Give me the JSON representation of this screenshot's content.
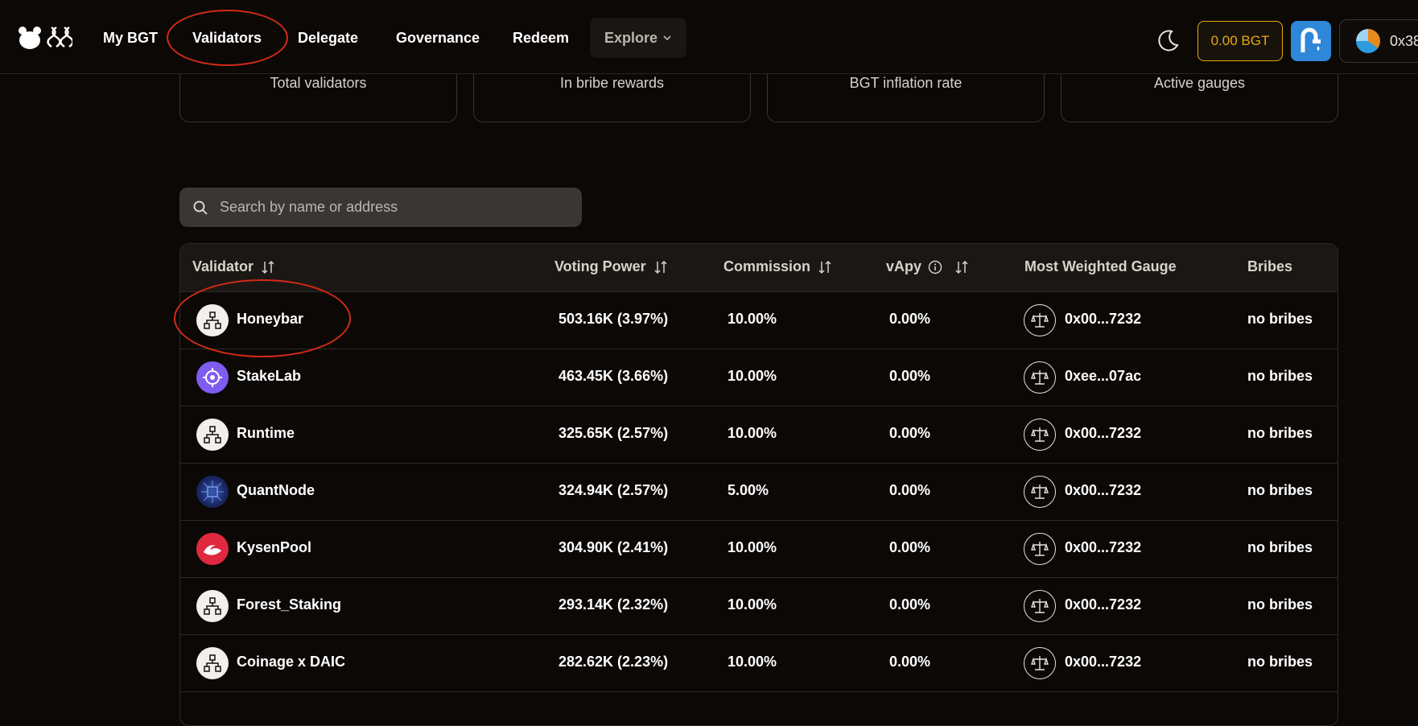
{
  "nav": {
    "items": [
      {
        "label": "My BGT"
      },
      {
        "label": "Validators"
      },
      {
        "label": "Delegate"
      },
      {
        "label": "Governance"
      },
      {
        "label": "Redeem"
      }
    ],
    "explore_label": "Explore",
    "balance": "0.00 BGT",
    "wallet_address": "0x38"
  },
  "stats": [
    {
      "label": "Total validators"
    },
    {
      "label": "In bribe rewards"
    },
    {
      "label": "BGT inflation rate"
    },
    {
      "label": "Active gauges"
    }
  ],
  "search": {
    "placeholder": "Search by name or address",
    "value": ""
  },
  "table": {
    "headers": {
      "validator": "Validator",
      "voting_power": "Voting Power",
      "commission": "Commission",
      "vapy": "vApy",
      "gauge": "Most Weighted Gauge",
      "bribes": "Bribes"
    },
    "rows": [
      {
        "name": "Honeybar",
        "voting_power": "503.16K (3.97%)",
        "commission": "10.00%",
        "vapy": "0.00%",
        "gauge": "0x00...7232",
        "bribes": "no bribes",
        "avatar": "network-icon"
      },
      {
        "name": "StakeLab",
        "voting_power": "463.45K (3.66%)",
        "commission": "10.00%",
        "vapy": "0.00%",
        "gauge": "0xee...07ac",
        "bribes": "no bribes",
        "avatar": "stakelab-logo"
      },
      {
        "name": "Runtime",
        "voting_power": "325.65K (2.57%)",
        "commission": "10.00%",
        "vapy": "0.00%",
        "gauge": "0x00...7232",
        "bribes": "no bribes",
        "avatar": "network-icon"
      },
      {
        "name": "QuantNode",
        "voting_power": "324.94K (2.57%)",
        "commission": "5.00%",
        "vapy": "0.00%",
        "gauge": "0x00...7232",
        "bribes": "no bribes",
        "avatar": "quantnode-logo"
      },
      {
        "name": "KysenPool",
        "voting_power": "304.90K (2.41%)",
        "commission": "10.00%",
        "vapy": "0.00%",
        "gauge": "0x00...7232",
        "bribes": "no bribes",
        "avatar": "kysenpool-logo"
      },
      {
        "name": "Forest_Staking",
        "voting_power": "293.14K (2.32%)",
        "commission": "10.00%",
        "vapy": "0.00%",
        "gauge": "0x00...7232",
        "bribes": "no bribes",
        "avatar": "network-icon"
      },
      {
        "name": "Coinage x DAIC",
        "voting_power": "282.62K (2.23%)",
        "commission": "10.00%",
        "vapy": "0.00%",
        "gauge": "0x00...7232",
        "bribes": "no bribes",
        "avatar": "network-icon"
      }
    ]
  },
  "colors": {
    "background": "#0b0806",
    "accent": "#e5a80e",
    "annotation": "#d42a16",
    "faucet": "#2e87d8"
  }
}
